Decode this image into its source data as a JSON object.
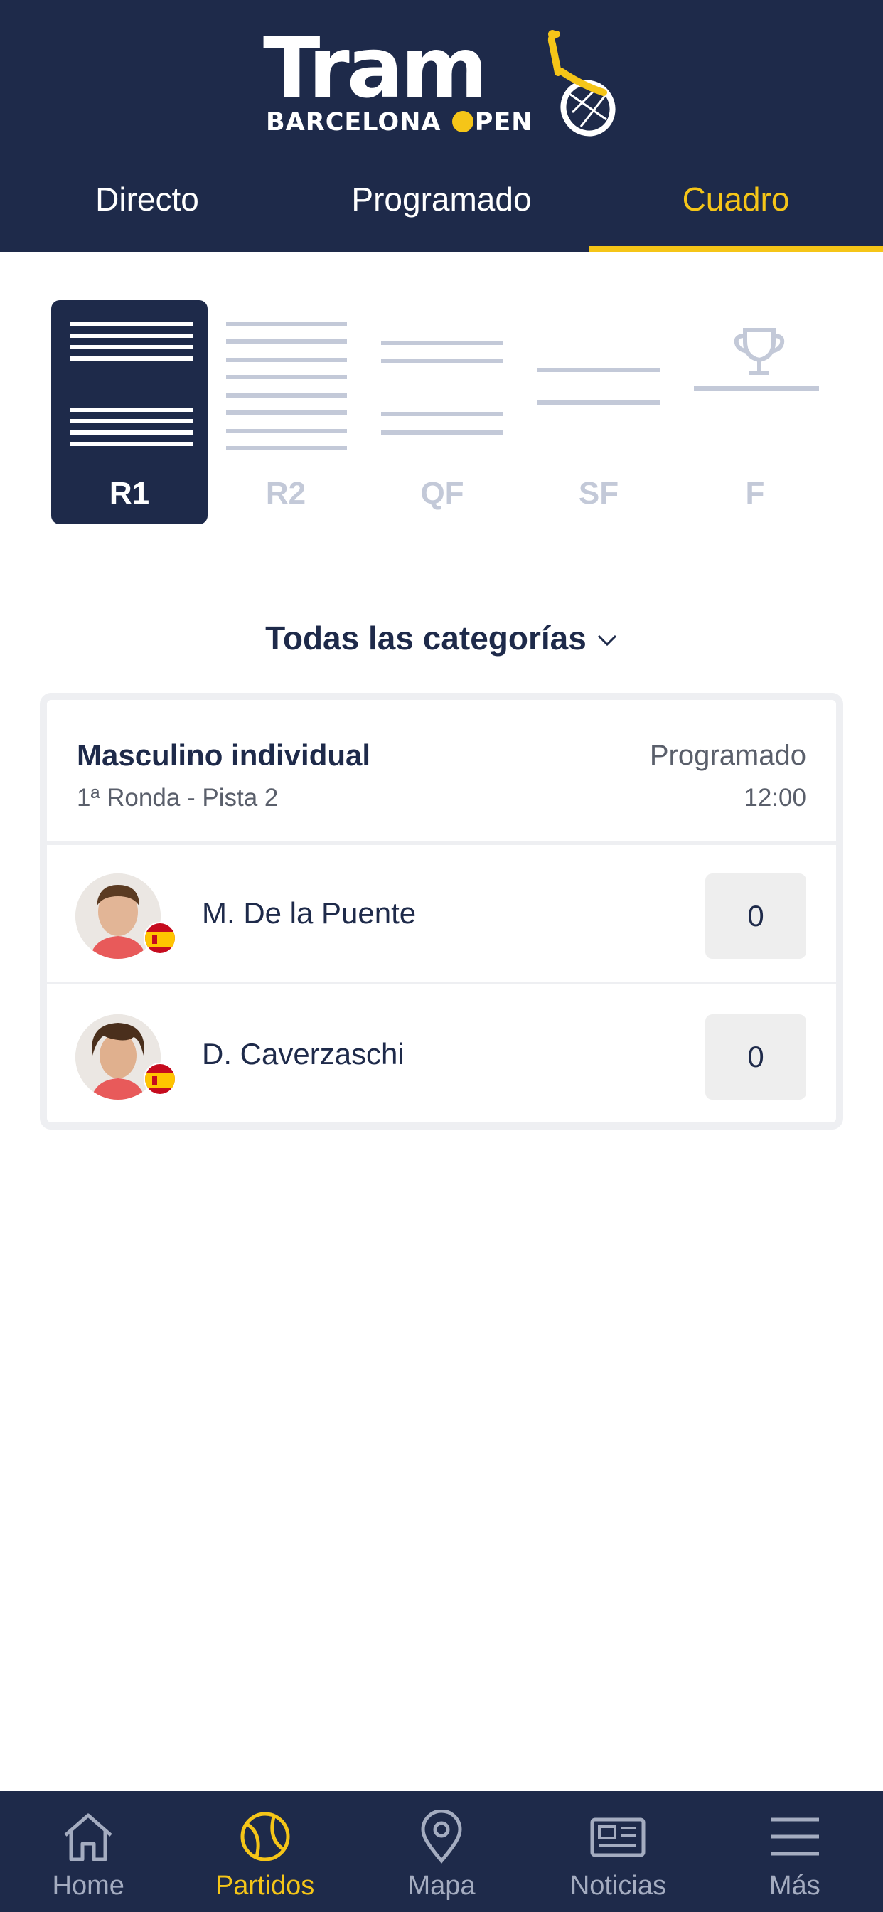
{
  "header": {
    "brand_word": "Tram",
    "brand_sub_left": "BARCELONA",
    "brand_sub_right": "PEN"
  },
  "tabs": [
    {
      "label": "Directo",
      "active": false
    },
    {
      "label": "Programado",
      "active": false
    },
    {
      "label": "Cuadro",
      "active": true
    }
  ],
  "rounds": [
    {
      "label": "R1",
      "active": true
    },
    {
      "label": "R2",
      "active": false
    },
    {
      "label": "QF",
      "active": false
    },
    {
      "label": "SF",
      "active": false
    },
    {
      "label": "F",
      "active": false
    }
  ],
  "category_filter": {
    "label": "Todas las categorías"
  },
  "match": {
    "category": "Masculino individual",
    "round_court": "1ª Ronda -  Pista 2",
    "status": "Programado",
    "time": "12:00",
    "players": [
      {
        "name": "M. De la Puente",
        "score": "0",
        "country": "Spain"
      },
      {
        "name": "D. Caverzaschi",
        "score": "0",
        "country": "Spain"
      }
    ]
  },
  "bottom_nav": [
    {
      "label": "Home",
      "icon": "home-icon",
      "active": false
    },
    {
      "label": "Partidos",
      "icon": "tennis-ball-icon",
      "active": true
    },
    {
      "label": "Mapa",
      "icon": "map-pin-icon",
      "active": false
    },
    {
      "label": "Noticias",
      "icon": "newspaper-icon",
      "active": false
    },
    {
      "label": "Más",
      "icon": "menu-icon",
      "active": false
    }
  ],
  "colors": {
    "navy": "#1e2a4a",
    "accent_yellow": "#f5c518",
    "inactive_gray": "#c3c9d8"
  }
}
